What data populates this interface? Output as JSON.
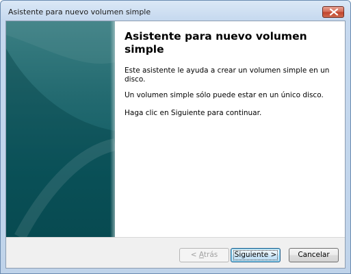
{
  "window": {
    "title": "Asistente para nuevo volumen simple"
  },
  "titlebar": {
    "close_icon": "close-icon",
    "close_color": "#c2442c"
  },
  "banner": {
    "colors": [
      "#3b7f83",
      "#0f5b63"
    ]
  },
  "main": {
    "heading": "Asistente para nuevo volumen simple",
    "paragraph_1": "Este asistente le ayuda a crear un volumen simple en un disco.",
    "paragraph_2": "Un volumen simple sólo puede estar en un único disco.",
    "paragraph_3": "Haga clic en Siguiente para continuar."
  },
  "buttons": {
    "back": {
      "prefix": "< ",
      "accel": "A",
      "rest": "trás",
      "enabled": false
    },
    "next": {
      "label": "Siguiente >",
      "focused": true
    },
    "cancel": {
      "label": "Cancelar"
    }
  }
}
